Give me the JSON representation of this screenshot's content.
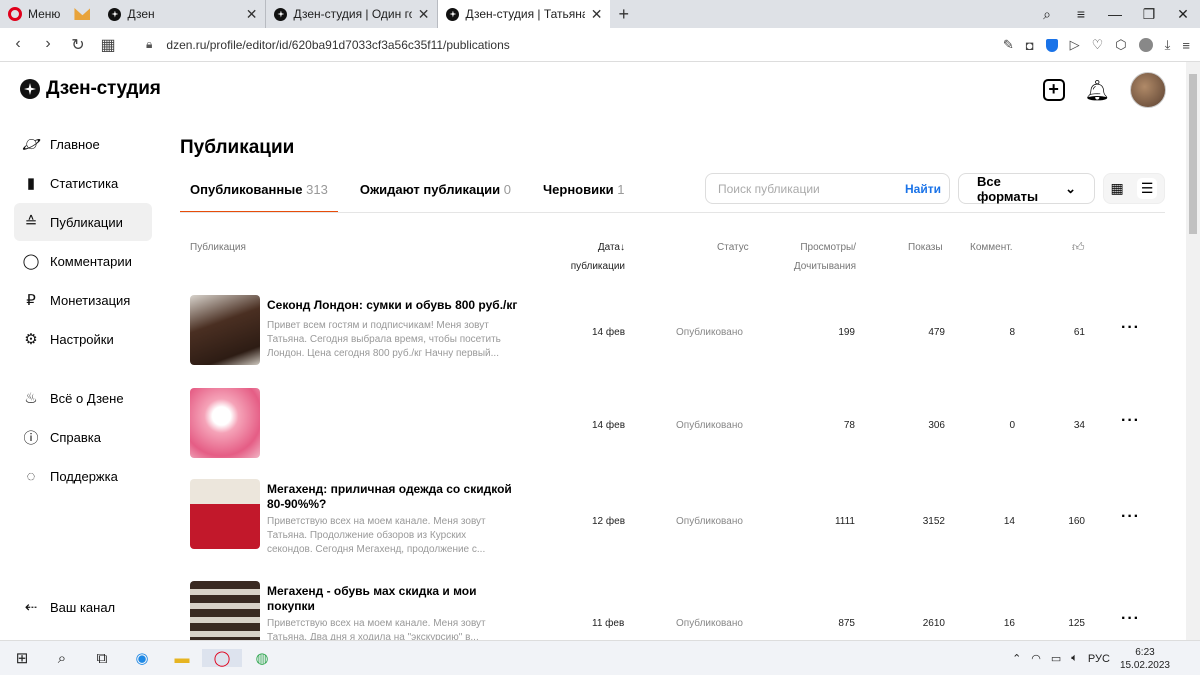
{
  "browser": {
    "menu_label": "Меню",
    "tabs": [
      {
        "label": "Дзен"
      },
      {
        "label": "Дзен-студия | Один год на"
      },
      {
        "label": "Дзен-студия | Татьяна Ш."
      }
    ],
    "url": "dzen.ru/profile/editor/id/620ba91d7033cf3a56c35f11/publications"
  },
  "header": {
    "logo": "Дзен-студия"
  },
  "sidebar": {
    "items": [
      {
        "label": "Главное",
        "icon": "planet-icon"
      },
      {
        "label": "Статистика",
        "icon": "bar-chart-icon"
      },
      {
        "label": "Публикации",
        "icon": "stack-icon"
      },
      {
        "label": "Комментарии",
        "icon": "comment-icon"
      },
      {
        "label": "Монетизация",
        "icon": "ruble-icon"
      },
      {
        "label": "Настройки",
        "icon": "gear-icon"
      },
      {
        "label": "Всё о Дзене",
        "icon": "flame-icon"
      },
      {
        "label": "Справка",
        "icon": "question-icon"
      },
      {
        "label": "Поддержка",
        "icon": "chat-icon"
      }
    ],
    "bottom": "Ваш канал"
  },
  "main": {
    "title": "Публикации",
    "tabs": [
      {
        "label": "Опубликованные",
        "count": "313"
      },
      {
        "label": "Ожидают публикации",
        "count": "0"
      },
      {
        "label": "Черновики",
        "count": "1"
      }
    ],
    "search": {
      "placeholder": "Поиск публикации",
      "button": "Найти"
    },
    "format_select": "Все форматы",
    "columns": {
      "publication": "Публикация",
      "date1": "Дата",
      "date2": "публикации",
      "status": "Статус",
      "views1": "Просмотры/",
      "views2": "Дочитывания",
      "shows": "Показы",
      "comments": "Коммент."
    },
    "rows": [
      {
        "title": "Секонд Лондон: сумки и обувь 800 руб./кг",
        "desc": "Привет всем гостям и подписчикам! Меня зовут Татьяна. Сегодня выбрала время, чтобы посетить Лондон. Цена сегодня 800 руб./кг Начну первый...",
        "date": "14 фев",
        "status": "Опубликовано",
        "views": "199",
        "shows": "479",
        "comments": "8",
        "likes": "61"
      },
      {
        "title": "",
        "desc": "",
        "date": "14 фев",
        "status": "Опубликовано",
        "views": "78",
        "shows": "306",
        "comments": "0",
        "likes": "34"
      },
      {
        "title": "Мегахенд: приличная одежда со скидкой 80-90%%?",
        "desc": "Приветствую всех на моем канале. Меня зовут Татьяна. Продолжение обзоров из Курских секондов. Сегодня Мегахенд, продолжение с...",
        "date": "12 фев",
        "status": "Опубликовано",
        "views": "1111",
        "shows": "3152",
        "comments": "14",
        "likes": "160"
      },
      {
        "title": "Мегахенд - обувь мах скидка и мои покупки",
        "desc": "Приветствую всех на моем канале. Меня зовут Татьяна. Два дня я ходила на \"экскурсию\" в...",
        "date": "11 фев",
        "status": "Опубликовано",
        "views": "875",
        "shows": "2610",
        "comments": "16",
        "likes": "125"
      }
    ]
  },
  "taskbar": {
    "lang": "РУС",
    "time": "6:23",
    "date": "15.02.2023"
  }
}
